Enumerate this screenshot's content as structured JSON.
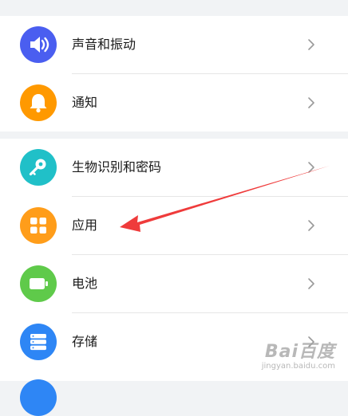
{
  "settings": {
    "items": [
      {
        "label": "声音和振动",
        "icon": "speaker-icon",
        "color": "#4a5ef0"
      },
      {
        "label": "通知",
        "icon": "bell-icon",
        "color": "#ff9900"
      },
      {
        "label": "生物识别和密码",
        "icon": "key-icon",
        "color": "#20c0c8"
      },
      {
        "label": "应用",
        "icon": "grid-apps-icon",
        "color": "#ff9d1a"
      },
      {
        "label": "电池",
        "icon": "battery-icon",
        "color": "#5fca4a"
      },
      {
        "label": "存储",
        "icon": "storage-icon",
        "color": "#2e86f5"
      }
    ]
  },
  "annotation": {
    "arrow_color": "#ef3b3b",
    "target": "应用"
  },
  "watermark": {
    "brand": "Bai百度",
    "url": "jingyan.baidu.com"
  }
}
